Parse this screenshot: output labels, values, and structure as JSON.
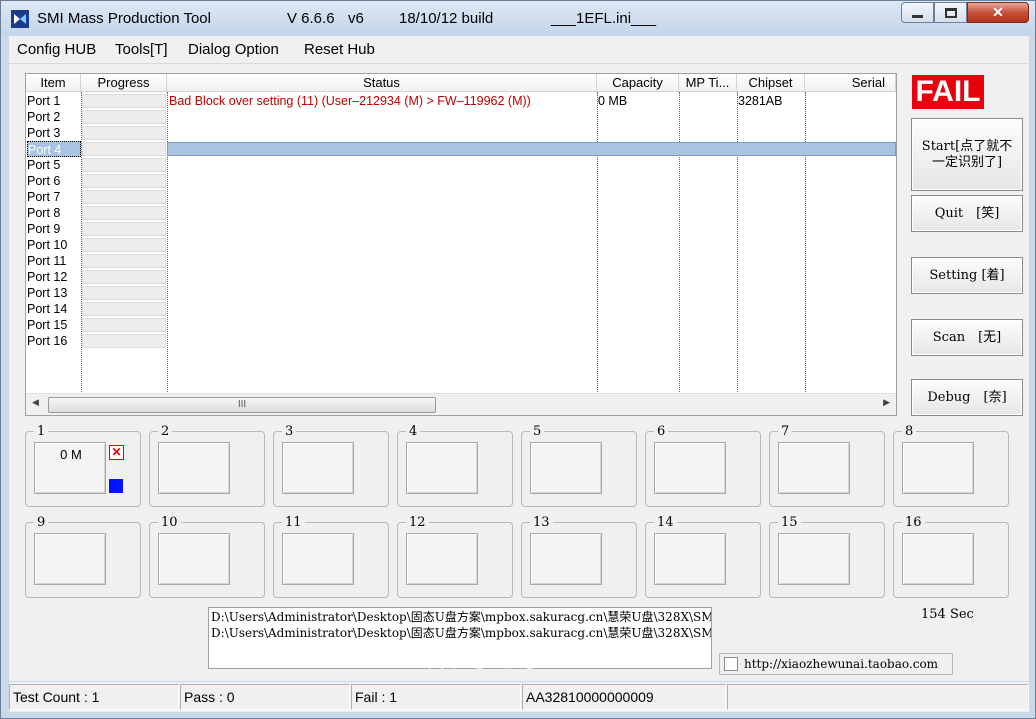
{
  "window": {
    "title": "SMI Mass Production Tool",
    "version": "V 6.6.6",
    "variant": "v6",
    "build": "18/10/12 build",
    "ini": "___1EFL.ini___"
  },
  "menu": [
    "Config HUB",
    "Tools[T]",
    "Dialog Option",
    "Reset Hub"
  ],
  "list": {
    "columns": [
      "Item",
      "Progress",
      "Status",
      "Capacity",
      "MP Ti...",
      "Chipset",
      "Serial"
    ],
    "rows": [
      {
        "item": "Port 1",
        "status": "Bad Block over setting (11) (User–212934 (M) > FW–119962 (M))",
        "capacity": "0 MB",
        "chipset": "3281AB"
      },
      {
        "item": "Port 2"
      },
      {
        "item": "Port 3"
      },
      {
        "item": "Port 4",
        "selected": true
      },
      {
        "item": "Port 5"
      },
      {
        "item": "Port 6"
      },
      {
        "item": "Port 7"
      },
      {
        "item": "Port 8"
      },
      {
        "item": "Port 9"
      },
      {
        "item": "Port 10"
      },
      {
        "item": "Port 11"
      },
      {
        "item": "Port 12"
      },
      {
        "item": "Port 13"
      },
      {
        "item": "Port 14"
      },
      {
        "item": "Port 15"
      },
      {
        "item": "Port 16"
      }
    ],
    "scroll_thumb_label": "III"
  },
  "result": {
    "label": "FAIL",
    "color": "#e8000d"
  },
  "buttons": {
    "start": "Start[点了就不一定识别了]",
    "quit": "Quit　[笑]",
    "setting": "Setting [着]",
    "scan": "Scan　[无]",
    "debug": "Debug　[奈]"
  },
  "ports": [
    {
      "num": "1",
      "capacity": "0 M"
    },
    {
      "num": "2"
    },
    {
      "num": "3"
    },
    {
      "num": "4"
    },
    {
      "num": "5"
    },
    {
      "num": "6"
    },
    {
      "num": "7"
    },
    {
      "num": "8"
    },
    {
      "num": "9"
    },
    {
      "num": "10"
    },
    {
      "num": "11"
    },
    {
      "num": "12"
    },
    {
      "num": "13"
    },
    {
      "num": "14"
    },
    {
      "num": "15"
    },
    {
      "num": "16"
    }
  ],
  "log": [
    "D:\\Users\\Administrator\\Desktop\\固态U盘方案\\mpbox.sakuracg.cn\\慧荣U盘\\328X\\SM",
    "D:\\Users\\Administrator\\Desktop\\固态U盘方案\\mpbox.sakuracg.cn\\慧荣U盘\\328X\\SM"
  ],
  "timer": "154 Sec",
  "link": {
    "text": "http://xiaozhewunai.taobao.com",
    "checked": false
  },
  "watermark": "数码之家",
  "status": {
    "test_count": "Test Count : 1",
    "pass": "Pass : 0",
    "fail": "Fail : 1",
    "serial": "AA32810000000009"
  },
  "colors": {
    "status_error": "#c00000",
    "selected_row": "#a8c4e0",
    "fail_bg": "#e8000d",
    "active_indicator": "#0014ff"
  }
}
